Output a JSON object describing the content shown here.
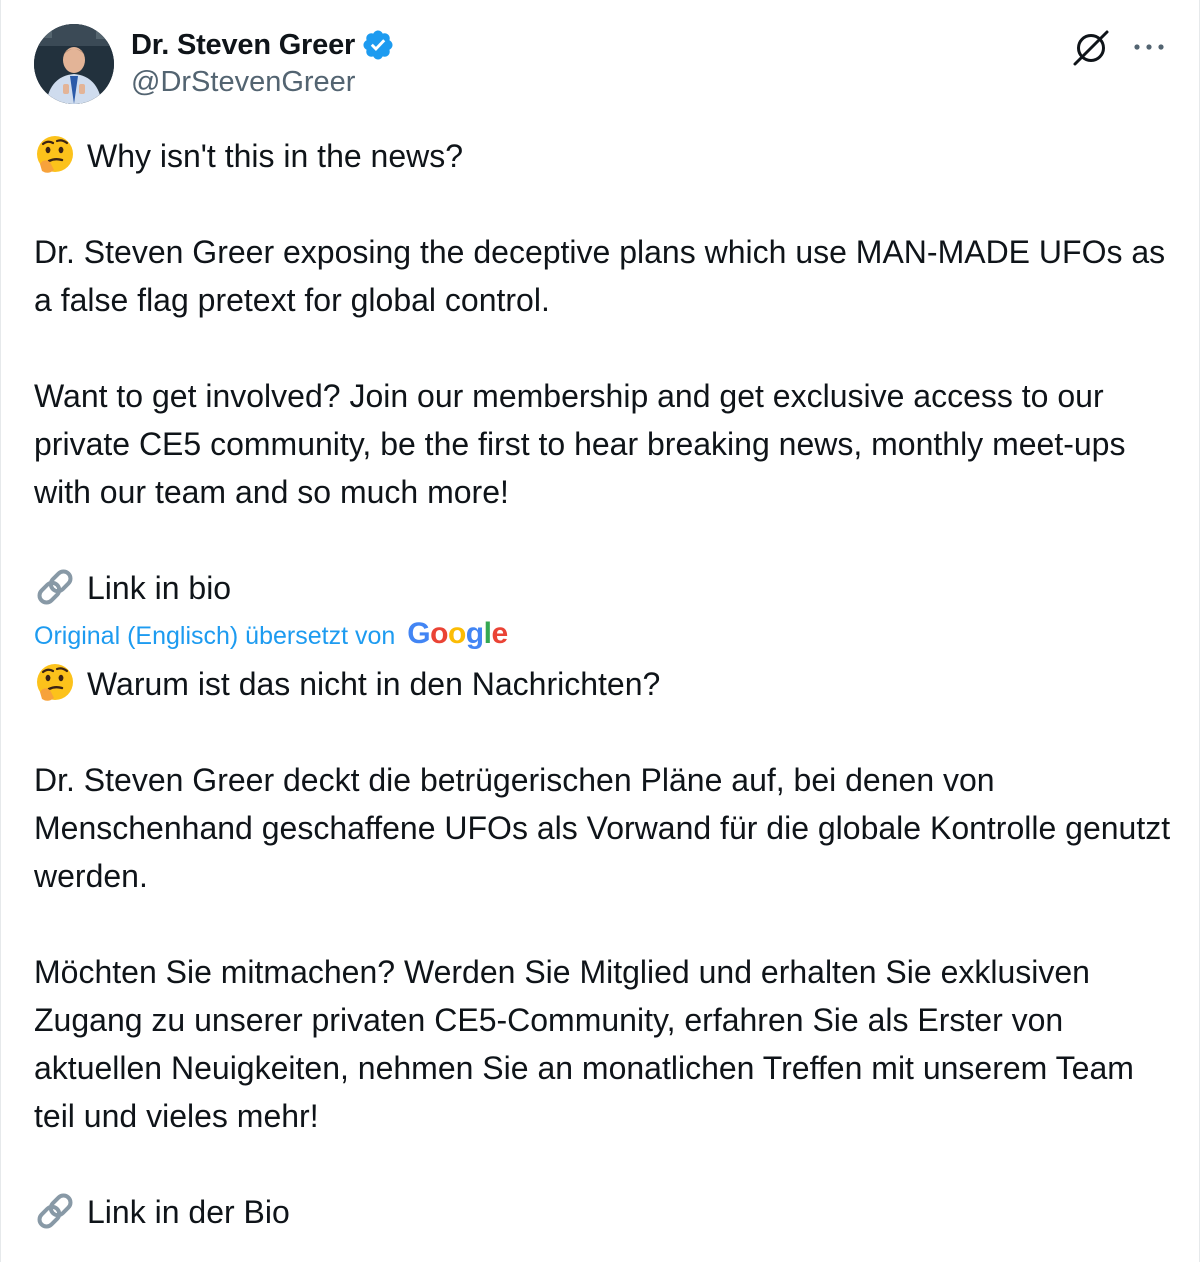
{
  "author": {
    "display_name": "Dr. Steven Greer",
    "handle": "@DrStevenGreer",
    "verified": true,
    "verified_color": "#1d9bf0"
  },
  "actions": {
    "grok_icon": "grok-icon",
    "more_icon": "more-icon"
  },
  "original": {
    "line1": "Why isn't this in the news?",
    "para2": "Dr. Steven Greer exposing the deceptive plans which use MAN-MADE UFOs as a false flag pretext for global control.",
    "para3": "Want to get involved? Join our membership and get exclusive access to our private CE5 community, be the first to hear breaking news, monthly meet-ups with our team and so much more!",
    "link": "Link in bio"
  },
  "translation": {
    "label": "Original (Englisch) übersetzt von",
    "provider_letters": [
      "G",
      "o",
      "o",
      "g",
      "l",
      "e"
    ],
    "line1": "Warum ist das nicht in den Nachrichten?",
    "para2": "Dr. Steven Greer deckt die betrügerischen Pläne auf, bei denen von Menschenhand geschaffene UFOs als Vorwand für die globale Kontrolle genutzt werden.",
    "para3": "Möchten Sie mitmachen? Werden Sie Mitglied und erhalten Sie exklusiven Zugang zu unserer privaten CE5-Community, erfahren Sie als Erster von aktuellen Neuigkeiten, nehmen Sie an monatlichen Treffen mit unserem Team teil und vieles mehr!",
    "link": "Link in der Bio"
  },
  "colors": {
    "text": "#0f1419",
    "secondary": "#536471",
    "accent": "#1d9bf0"
  }
}
